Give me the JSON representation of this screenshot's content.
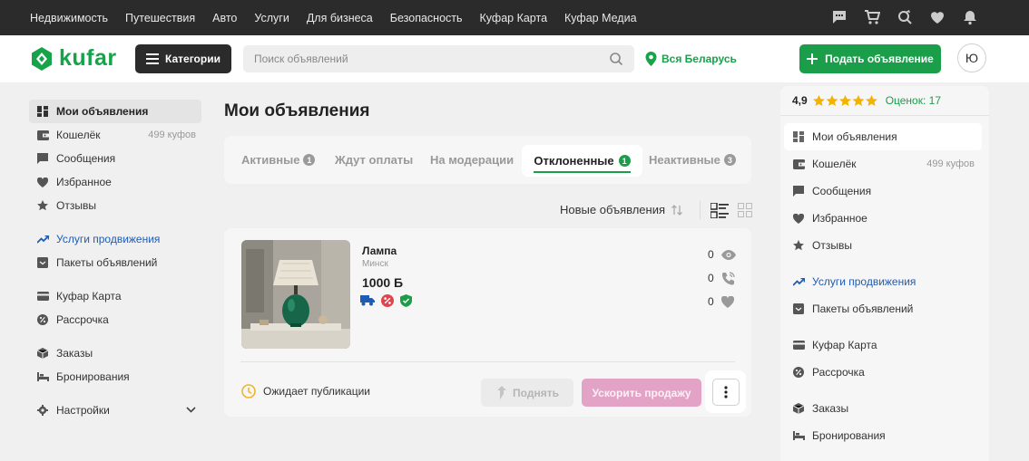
{
  "topnav": [
    "Недвижимость",
    "Путешествия",
    "Авто",
    "Услуги",
    "Для бизнеса",
    "Безопасность",
    "Куфар Карта",
    "Куфар Медиа"
  ],
  "header": {
    "logo_text": "kufar",
    "categories_label": "Категории",
    "search_placeholder": "Поиск объявлений",
    "region": "Вся Беларусь",
    "post_label": "Подать объявление",
    "avatar_letter": "Ю"
  },
  "sidebar": {
    "my_ads": "Мои объявления",
    "wallet": "Кошелёк",
    "wallet_balance": "499 куфов",
    "messages": "Сообщения",
    "favorites": "Избранное",
    "reviews": "Отзывы",
    "promo": "Услуги продвижения",
    "packages": "Пакеты объявлений",
    "card": "Куфар Карта",
    "installment": "Рассрочка",
    "orders": "Заказы",
    "bookings": "Бронирования",
    "settings": "Настройки"
  },
  "main": {
    "title": "Мои объявления",
    "tabs": [
      {
        "label": "Активные",
        "count": "1"
      },
      {
        "label": "Ждут оплаты",
        "count": ""
      },
      {
        "label": "На модерации",
        "count": ""
      },
      {
        "label": "Отклоненные",
        "count": "1"
      },
      {
        "label": "Неактивные",
        "count": "3"
      }
    ],
    "sort_label": "Новые объявления"
  },
  "ad": {
    "title": "Лампа",
    "city": "Минск",
    "price": "1000 Б",
    "views": "0",
    "calls": "0",
    "favorites": "0",
    "status": "Ожидает публикации",
    "raise_label": "Поднять",
    "boost_label": "Ускорить продажу"
  },
  "right": {
    "rating": "4,9",
    "stars": 5,
    "reviews_label": "Оценок: 17"
  },
  "colors": {
    "brand_green": "#1a9e4a",
    "link_blue": "#1e5bb5",
    "boost_pink": "#e2a3c6",
    "star": "#f5b301"
  }
}
